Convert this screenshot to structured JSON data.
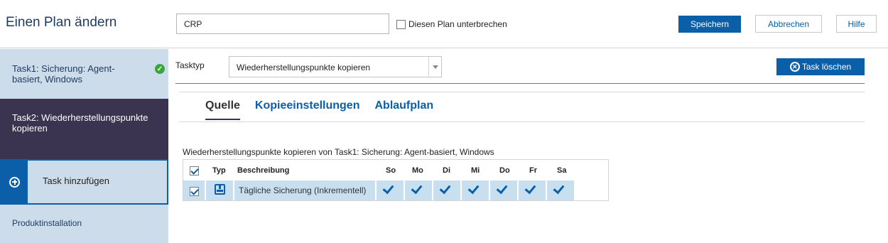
{
  "header": {
    "title": "Einen Plan ändern",
    "plan_name_value": "CRP",
    "pause_label": "Diesen Plan unterbrechen",
    "save_label": "Speichern",
    "cancel_label": "Abbrechen",
    "help_label": "Hilfe"
  },
  "sidebar": {
    "items": [
      {
        "label": "Task1: Sicherung: Agent-basiert, Windows",
        "status": "completed"
      },
      {
        "label": "Task2: Wiederherstellungspunkte kopieren",
        "status": "selected"
      },
      {
        "label": "Task hinzufügen"
      },
      {
        "label": "Produktinstallation"
      }
    ]
  },
  "main": {
    "tasktyp_label": "Tasktyp",
    "tasktyp_value": "Wiederherstellungspunkte kopieren",
    "delete_label": "Task löschen",
    "tabs": [
      {
        "label": "Quelle",
        "active": true
      },
      {
        "label": "Kopieeinstellungen",
        "active": false
      },
      {
        "label": "Ablaufplan",
        "active": false
      }
    ],
    "copy_from_text": "Wiederherstellungspunkte kopieren von Task1: Sicherung: Agent-basiert, Windows"
  },
  "schedule_table": {
    "columns": [
      "Typ",
      "Beschreibung",
      "So",
      "Mo",
      "Di",
      "Mi",
      "Do",
      "Fr",
      "Sa"
    ],
    "rows": [
      {
        "selected": true,
        "type_icon": "backup-icon",
        "description": "Tägliche Sicherung (Inkrementell)",
        "days": [
          true,
          true,
          true,
          true,
          true,
          true,
          true
        ]
      }
    ]
  },
  "colors": {
    "primary": "#0a5fa8",
    "sidebar_bg": "#ccdcea",
    "sidebar_selected": "#3a3450",
    "row_highlight": "#c8dff0",
    "success": "#3aa53a"
  }
}
